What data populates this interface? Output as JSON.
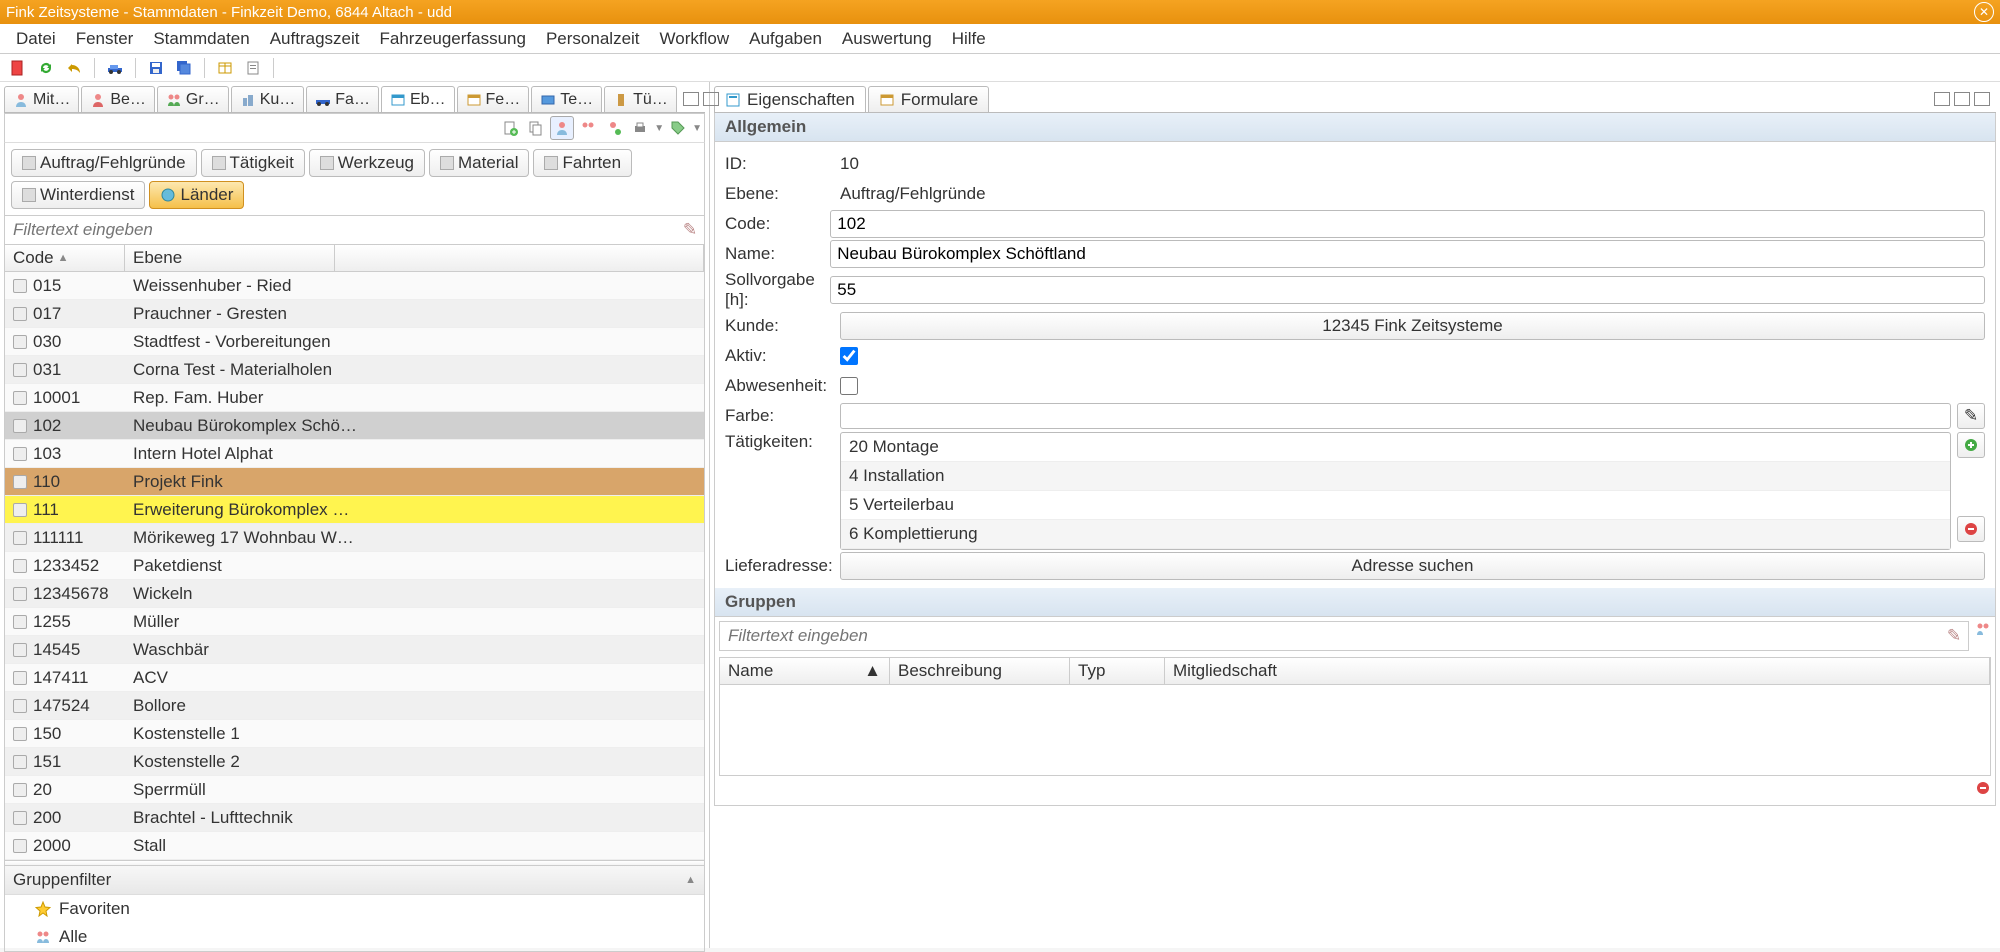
{
  "window": {
    "title": "Fink Zeitsysteme - Stammdaten - Finkzeit Demo, 6844 Altach - udd"
  },
  "menu": [
    "Datei",
    "Fenster",
    "Stammdaten",
    "Auftragszeit",
    "Fahrzeugerfassung",
    "Personalzeit",
    "Workflow",
    "Aufgaben",
    "Auswertung",
    "Hilfe"
  ],
  "leftTabs": [
    "Mit…",
    "Be…",
    "Gr…",
    "Ku…",
    "Fa…",
    "Eb…",
    "Fe…",
    "Te…",
    "Tü…"
  ],
  "leftTabActive": 5,
  "filterButtons": [
    {
      "label": "Auftrag/Fehlgründe"
    },
    {
      "label": "Tätigkeit"
    },
    {
      "label": "Werkzeug"
    },
    {
      "label": "Material"
    },
    {
      "label": "Fahrten"
    },
    {
      "label": "Winterdienst"
    },
    {
      "label": "Länder",
      "orange": true
    }
  ],
  "filterPlaceholder": "Filtertext eingeben",
  "tableHeaders": {
    "code": "Code",
    "ebene": "Ebene"
  },
  "rows": [
    {
      "code": "015",
      "ebene": "Weissenhuber - Ried"
    },
    {
      "code": "017",
      "ebene": "Prauchner - Gresten"
    },
    {
      "code": "030",
      "ebene": "Stadtfest - Vorbereitungen"
    },
    {
      "code": "031",
      "ebene": "Corna Test - Materialholen"
    },
    {
      "code": "10001",
      "ebene": "Rep. Fam. Huber"
    },
    {
      "code": "102",
      "ebene": "Neubau Bürokomplex Schö…",
      "selected": true
    },
    {
      "code": "103",
      "ebene": "Intern Hotel Alphat"
    },
    {
      "code": "110",
      "ebene": "Projekt Fink",
      "orange": true
    },
    {
      "code": "111",
      "ebene": "Erweiterung Bürokomplex …",
      "yellow": true
    },
    {
      "code": "111111",
      "ebene": "Mörikeweg 17 Wohnbau W…"
    },
    {
      "code": "1233452",
      "ebene": "Paketdienst"
    },
    {
      "code": "12345678",
      "ebene": "Wickeln"
    },
    {
      "code": "1255",
      "ebene": "Müller"
    },
    {
      "code": "14545",
      "ebene": "Waschbär"
    },
    {
      "code": "147411",
      "ebene": "ACV"
    },
    {
      "code": "147524",
      "ebene": "Bollore"
    },
    {
      "code": "150",
      "ebene": "Kostenstelle 1"
    },
    {
      "code": "151",
      "ebene": "Kostenstelle 2"
    },
    {
      "code": "20",
      "ebene": "Sperrmüll"
    },
    {
      "code": "200",
      "ebene": "Brachtel - Lufttechnik"
    },
    {
      "code": "2000",
      "ebene": "Stall"
    }
  ],
  "gruppenfilter": {
    "header": "Gruppenfilter",
    "items": [
      {
        "label": "Favoriten",
        "icon": "star"
      },
      {
        "label": "Alle",
        "icon": "people"
      }
    ]
  },
  "rightTabs": [
    "Eigenschaften",
    "Formulare"
  ],
  "rightTabActive": 0,
  "sections": {
    "allgemein": "Allgemein",
    "gruppen": "Gruppen"
  },
  "form": {
    "labels": {
      "id": "ID:",
      "ebene": "Ebene:",
      "code": "Code:",
      "name": "Name:",
      "sollvorgabe": "Sollvorgabe [h]:",
      "kunde": "Kunde:",
      "aktiv": "Aktiv:",
      "abwesenheit": "Abwesenheit:",
      "farbe": "Farbe:",
      "taetigkeiten": "Tätigkeiten:",
      "lieferadresse": "Lieferadresse:"
    },
    "values": {
      "id": "10",
      "ebene": "Auftrag/Fehlgründe",
      "code": "102",
      "name": "Neubau Bürokomplex Schöftland",
      "sollvorgabe": "55",
      "kunde": "12345 Fink Zeitsysteme",
      "aktiv": true,
      "abwesenheit": false,
      "taetigkeiten": [
        "20 Montage",
        "4 Installation",
        "5 Verteilerbau",
        "6 Komplettierung"
      ],
      "lieferadresse": "Adresse suchen"
    }
  },
  "gruppenTable": {
    "filterPlaceholder": "Filtertext eingeben",
    "headers": {
      "name": "Name",
      "beschreibung": "Beschreibung",
      "typ": "Typ",
      "mitgliedschaft": "Mitgliedschaft"
    }
  }
}
